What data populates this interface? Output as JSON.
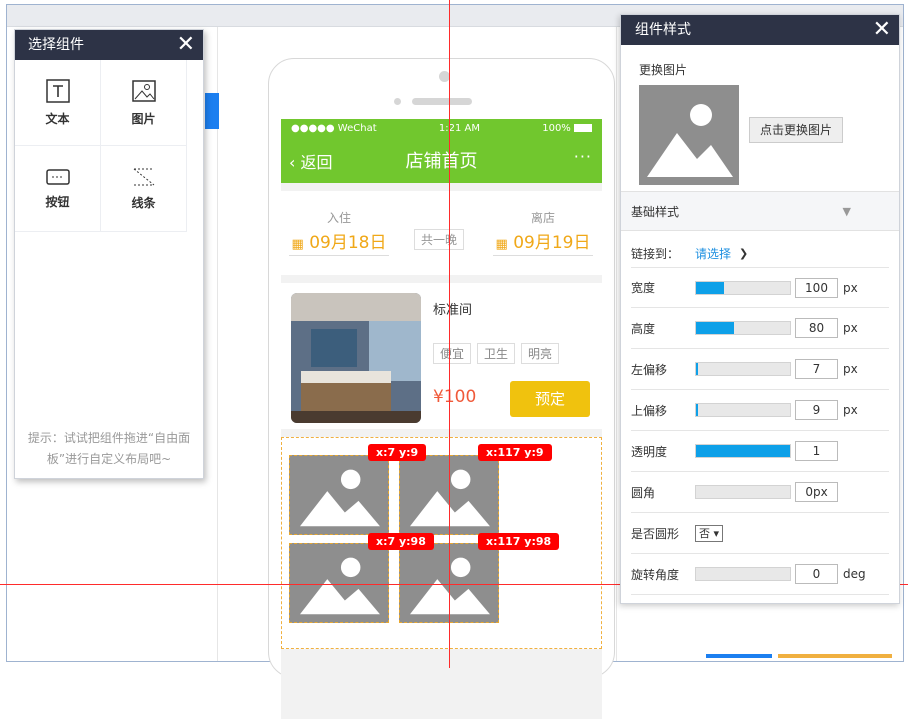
{
  "components_panel": {
    "title": "选择组件",
    "items": [
      {
        "label": "文本",
        "icon": "text-icon"
      },
      {
        "label": "图片",
        "icon": "image-icon"
      },
      {
        "label": "按钮",
        "icon": "button-icon"
      },
      {
        "label": "线条",
        "icon": "line-icon"
      }
    ],
    "hint": "提示：试试把组件拖进“自由面板”进行自定义布局吧~"
  },
  "phone": {
    "status": {
      "carrier": "●●●●● WeChat",
      "time": "1:21 AM",
      "battery": "100%"
    },
    "nav": {
      "back": "返回",
      "title": "店铺首页",
      "more": "···"
    },
    "checkin": {
      "label": "入住",
      "date": "09月18日"
    },
    "checkout": {
      "label": "离店",
      "date": "09月19日"
    },
    "nights": "共一晚",
    "room": {
      "name": "标准间",
      "tags": [
        "便宜",
        "卫生",
        "明亮"
      ],
      "price": "¥100",
      "book": "预定"
    },
    "badges": [
      "x:7 y:9",
      "x:117 y:9",
      "x:7 y:98",
      "x:117 y:98"
    ]
  },
  "style_panel": {
    "title": "组件样式",
    "change_label": "更换图片",
    "change_button": "点击更换图片",
    "section": "基础样式",
    "link_label": "链接到：",
    "link_value": "请选择",
    "rows": [
      {
        "label": "宽度",
        "value": "100",
        "unit": "px",
        "fill": 0.3
      },
      {
        "label": "高度",
        "value": "80",
        "unit": "px",
        "fill": 0.4
      },
      {
        "label": "左偏移",
        "value": "7",
        "unit": "px",
        "fill": 0.02
      },
      {
        "label": "上偏移",
        "value": "9",
        "unit": "px",
        "fill": 0.02
      },
      {
        "label": "透明度",
        "value": "1",
        "unit": "",
        "fill": 1.0
      },
      {
        "label": "圆角",
        "value": "0px",
        "unit": "",
        "fill": 0
      }
    ],
    "round_label": "是否圆形",
    "round_value": "否",
    "rotate_label": "旋转角度",
    "rotate_value": "0",
    "rotate_unit": "deg",
    "accent": "#0ea0e8"
  }
}
